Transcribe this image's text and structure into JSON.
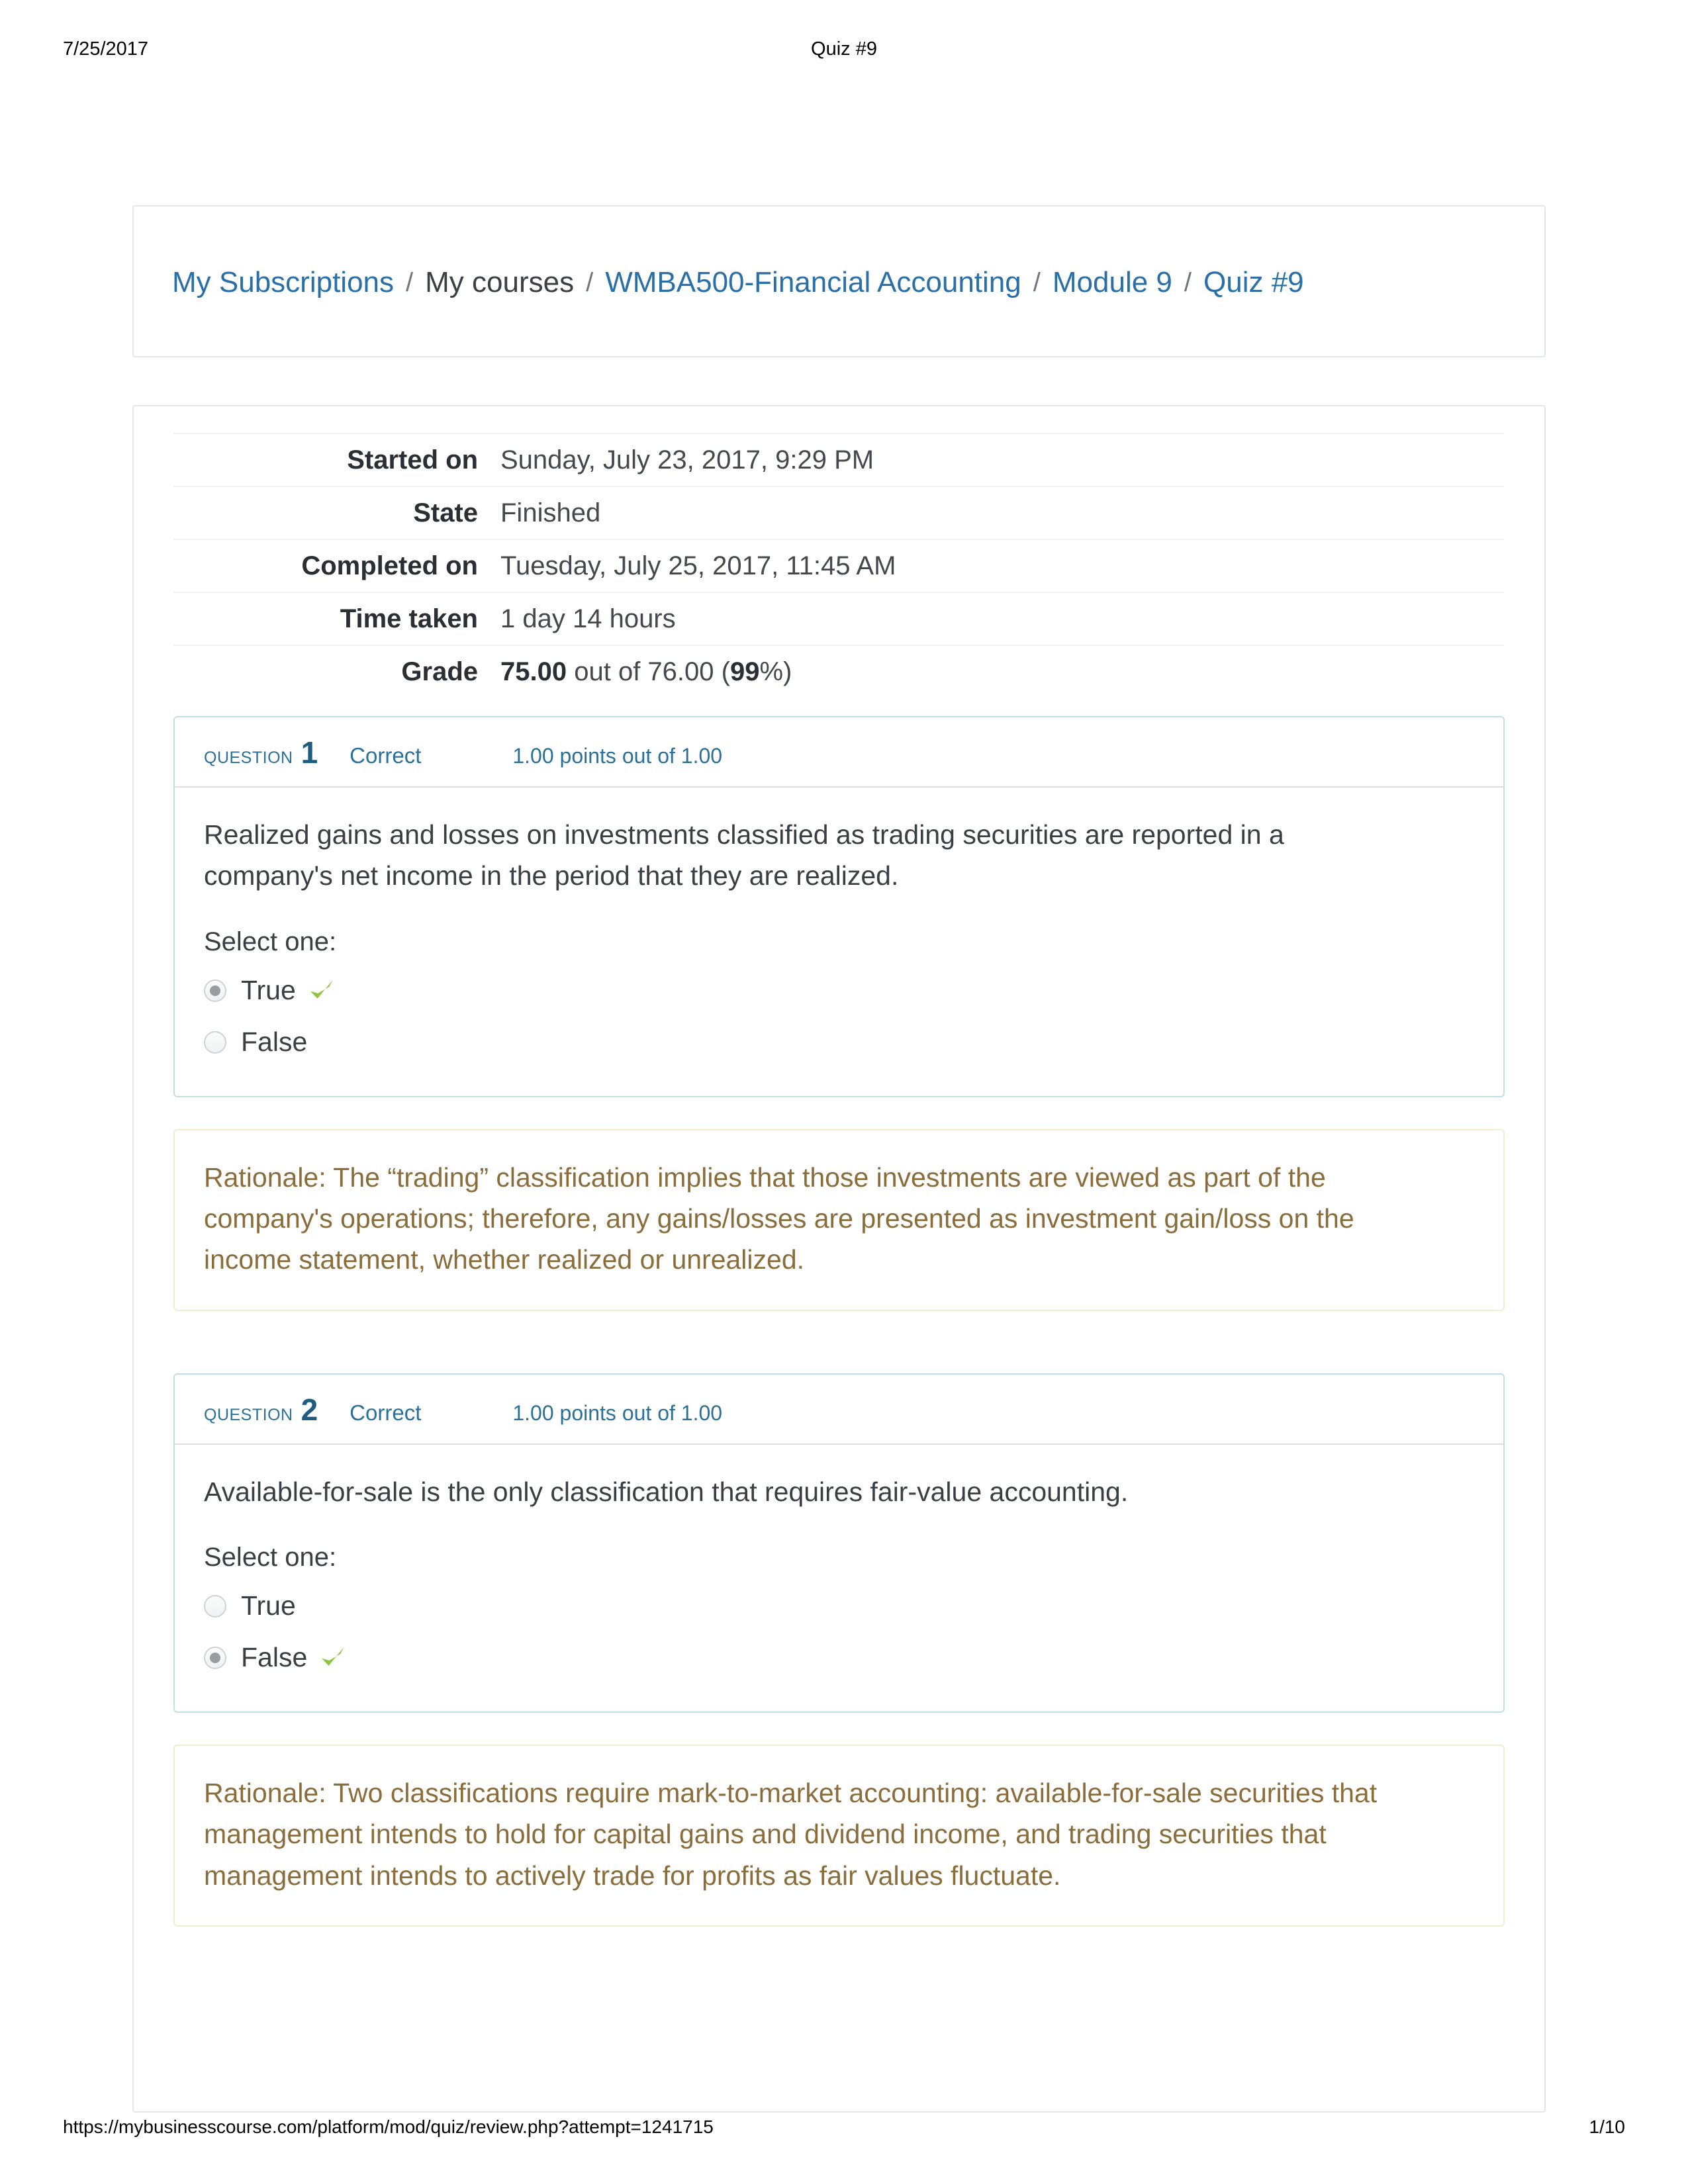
{
  "print": {
    "date": "7/25/2017",
    "title": "Quiz #9",
    "url": "https://mybusinesscourse.com/platform/mod/quiz/review.php?attempt=1241715",
    "page": "1/10"
  },
  "breadcrumb": {
    "items": [
      {
        "label": "My Subscriptions",
        "link": true
      },
      {
        "label": "My courses",
        "link": false
      },
      {
        "label": "WMBA500-Financial Accounting",
        "link": true
      },
      {
        "label": "Module 9",
        "link": true
      },
      {
        "label": "Quiz #9",
        "link": true
      }
    ],
    "separator": "/"
  },
  "summary": {
    "rows": [
      {
        "label": "Started on",
        "value": "Sunday, July 23, 2017, 9:29 PM"
      },
      {
        "label": "State",
        "value": "Finished"
      },
      {
        "label": "Completed on",
        "value": "Tuesday, July 25, 2017, 11:45 AM"
      },
      {
        "label": "Time taken",
        "value": "1 day 14 hours"
      }
    ],
    "grade": {
      "label": "Grade",
      "score": "75.00",
      "middle": " out of 76.00 (",
      "percent": "99",
      "suffix": "%)"
    }
  },
  "questions": [
    {
      "word": "Question",
      "number": "1",
      "state": "Correct",
      "marks": "1.00 points out of 1.00",
      "text": "Realized gains and losses on investments classified as trading securities are reported in a company's net income in the period that they are realized.",
      "select_prompt": "Select one:",
      "options": [
        {
          "label": "True",
          "selected": true,
          "correct_tick": true
        },
        {
          "label": "False",
          "selected": false,
          "correct_tick": false
        }
      ],
      "rationale": "Rationale: The “trading” classification implies that those investments are viewed as part of the company's operations; therefore, any gains/losses are presented as investment gain/loss on the income statement, whether realized or unrealized."
    },
    {
      "word": "Question",
      "number": "2",
      "state": "Correct",
      "marks": "1.00 points out of 1.00",
      "text": "Available-for-sale is the only classification that requires fair-value accounting.",
      "select_prompt": "Select one:",
      "options": [
        {
          "label": "True",
          "selected": false,
          "correct_tick": false
        },
        {
          "label": "False",
          "selected": true,
          "correct_tick": true
        }
      ],
      "rationale": "Rationale: Two classifications require mark-to-market accounting: available-for-sale securities that management intends to hold for capital gains and dividend income, and trading securities that management intends to actively trade for profits as fair values fluctuate."
    }
  ],
  "colors": {
    "link": "#2a6fa8",
    "question_accent": "#2b7099",
    "rationale_text": "#8a6d3b",
    "tick_green": "#8cc63f"
  }
}
